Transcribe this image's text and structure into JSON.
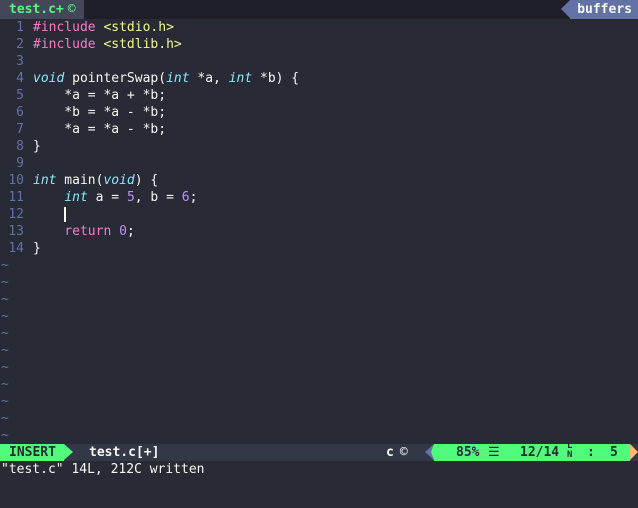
{
  "tabline": {
    "active_tab": "test.c+",
    "active_tab_icon": "c-file-icon",
    "buffers_label": "buffers"
  },
  "editor": {
    "lines": [
      {
        "num": "1",
        "tokens": [
          {
            "c": "kw-pre",
            "t": "#include"
          },
          {
            "c": "plain",
            "t": " "
          },
          {
            "c": "str",
            "t": "<stdio.h>"
          }
        ]
      },
      {
        "num": "2",
        "tokens": [
          {
            "c": "kw-pre",
            "t": "#include"
          },
          {
            "c": "plain",
            "t": " "
          },
          {
            "c": "str",
            "t": "<stdlib.h>"
          }
        ]
      },
      {
        "num": "3",
        "tokens": []
      },
      {
        "num": "4",
        "tokens": [
          {
            "c": "type",
            "t": "void"
          },
          {
            "c": "plain",
            "t": " pointerSwap("
          },
          {
            "c": "type",
            "t": "int"
          },
          {
            "c": "plain",
            "t": " *a, "
          },
          {
            "c": "type",
            "t": "int"
          },
          {
            "c": "plain",
            "t": " *b) {"
          }
        ]
      },
      {
        "num": "5",
        "tokens": [
          {
            "c": "plain",
            "t": "    *a = *a + *b;"
          }
        ]
      },
      {
        "num": "6",
        "tokens": [
          {
            "c": "plain",
            "t": "    *b = *a - *b;"
          }
        ]
      },
      {
        "num": "7",
        "tokens": [
          {
            "c": "plain",
            "t": "    *a = *a - *b;"
          }
        ]
      },
      {
        "num": "8",
        "tokens": [
          {
            "c": "plain",
            "t": "}"
          }
        ]
      },
      {
        "num": "9",
        "tokens": []
      },
      {
        "num": "10",
        "tokens": [
          {
            "c": "type",
            "t": "int"
          },
          {
            "c": "plain",
            "t": " main("
          },
          {
            "c": "type",
            "t": "void"
          },
          {
            "c": "plain",
            "t": ") {"
          }
        ]
      },
      {
        "num": "11",
        "tokens": [
          {
            "c": "plain",
            "t": "    "
          },
          {
            "c": "type",
            "t": "int"
          },
          {
            "c": "plain",
            "t": " a = "
          },
          {
            "c": "num",
            "t": "5"
          },
          {
            "c": "plain",
            "t": ", b = "
          },
          {
            "c": "num",
            "t": "6"
          },
          {
            "c": "plain",
            "t": ";"
          }
        ]
      },
      {
        "num": "12",
        "tokens": [
          {
            "c": "plain",
            "t": "    "
          }
        ],
        "cursor": true
      },
      {
        "num": "13",
        "tokens": [
          {
            "c": "plain",
            "t": "    "
          },
          {
            "c": "kw",
            "t": "return"
          },
          {
            "c": "plain",
            "t": " "
          },
          {
            "c": "num",
            "t": "0"
          },
          {
            "c": "plain",
            "t": ";"
          }
        ]
      },
      {
        "num": "14",
        "tokens": [
          {
            "c": "plain",
            "t": "}"
          }
        ]
      }
    ],
    "filler_char": "~",
    "filler_count": 11
  },
  "statusline": {
    "mode": "INSERT",
    "filename": "test.c[+]",
    "filetype": "c",
    "filetype_icon": "c-file-icon",
    "percent": "85%",
    "lines_icon": "☰",
    "line_position": "12/14",
    "ln_icon": "L\nN",
    "colon": ":",
    "column": "5"
  },
  "cmdline": {
    "message": "\"test.c\" 14L, 212C written"
  },
  "colors": {
    "background": "#282a36",
    "accent_green": "#50fa7b",
    "line_number": "#6272a4",
    "string": "#f1fa8c",
    "keyword": "#ff79c6",
    "type": "#8be9fd",
    "number": "#bd93f9"
  }
}
